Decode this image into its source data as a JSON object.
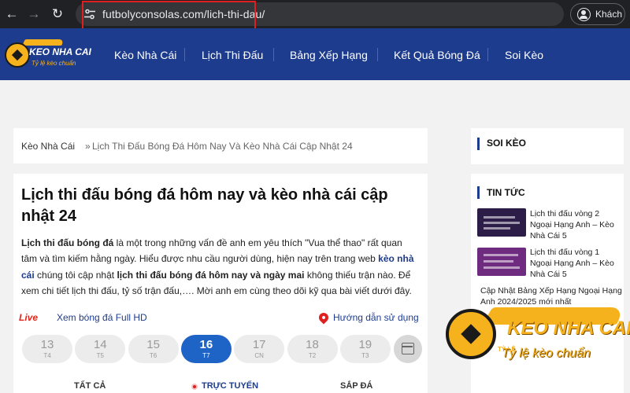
{
  "browser": {
    "url": "futbolyconsolas.com/lich-thi-dau/",
    "profile_label": "Khách",
    "back_glyph": "←",
    "forward_glyph": "→",
    "reload_glyph": "↻"
  },
  "header": {
    "logo": {
      "brand": "KEO NHA CAI",
      "slogan": "Tỷ lệ kèo chuẩn"
    },
    "nav": [
      "Kèo Nhà Cái",
      "Lịch Thi Đấu",
      "Bảng Xếp Hạng",
      "Kết Quả Bóng Đá",
      "Soi Kèo"
    ]
  },
  "breadcrumb": {
    "home": "Kèo Nhà Cái",
    "separator": "»",
    "current": "Lịch Thi Đấu Bóng Đá Hôm Nay Và Kèo Nhà Cái Cập Nhật 24"
  },
  "article": {
    "title": "Lịch thi đấu bóng đá hôm nay và kèo nhà cái cập nhật 24",
    "intro": {
      "s1_bold": "Lịch thi đấu bóng đá",
      "s2": " là một trong những vấn đề anh em yêu thích \"Vua thể thao\" rất quan tâm và tìm kiếm hằng ngày. Hiểu được nhu cầu người dùng, hiện nay trên trang web ",
      "s3_link": "kèo nhà cái",
      "s4": " chúng tôi cập nhật ",
      "s5_bold": "lịch thi đấu bóng đá hôm nay và ngày mai",
      "s6": " không thiếu trận nào. Để xem chi tiết lịch thi đấu, tỷ số trận đấu,…. Mời anh em cùng theo dõi kỹ qua bài viết dưới đây."
    },
    "live_badge": "Live",
    "live_link": "Xem bóng đá Full HD",
    "guide_link": "Hướng dẫn sử dụng",
    "days": [
      {
        "num": "13",
        "wd": "T4"
      },
      {
        "num": "14",
        "wd": "T5"
      },
      {
        "num": "15",
        "wd": "T6"
      },
      {
        "num": "16",
        "wd": "T7"
      },
      {
        "num": "17",
        "wd": "CN"
      },
      {
        "num": "18",
        "wd": "T2"
      },
      {
        "num": "19",
        "wd": "T3"
      }
    ],
    "active_day_index": 3,
    "tabs": [
      "TẤT CẢ",
      "TRỰC TUYẾN",
      "SẮP ĐÁ"
    ]
  },
  "sidebar": {
    "soi_keo_title": "SOI KÈO",
    "tin_tuc_title": "TIN TỨC",
    "news": [
      "Lịch thi đấu vòng 2 Ngoại Hạng Anh – Kèo Nhà Cái 5",
      "Lịch thi đấu vòng 1 Ngoại Hạng Anh – Kèo Nhà Cái 5",
      "Cập Nhật Bảng Xếp Hạng Ngoại Hạng Anh 2024/2025 mới nhất"
    ]
  },
  "watermark": {
    "brand": "KEO NHA CAI",
    "tyle": "TỶ LỆ",
    "slogan": "Tỷ lệ kèo chuẩn"
  },
  "colors": {
    "brand_blue": "#1e3c8d",
    "accent_gold": "#f6b21c",
    "active_day": "#1e63c6",
    "live_red": "#e0251b"
  },
  "icons": [
    "back-icon",
    "forward-icon",
    "reload-icon",
    "site-settings-icon",
    "profile-icon",
    "calendar-icon",
    "guide-pin-icon",
    "live-record-icon"
  ]
}
